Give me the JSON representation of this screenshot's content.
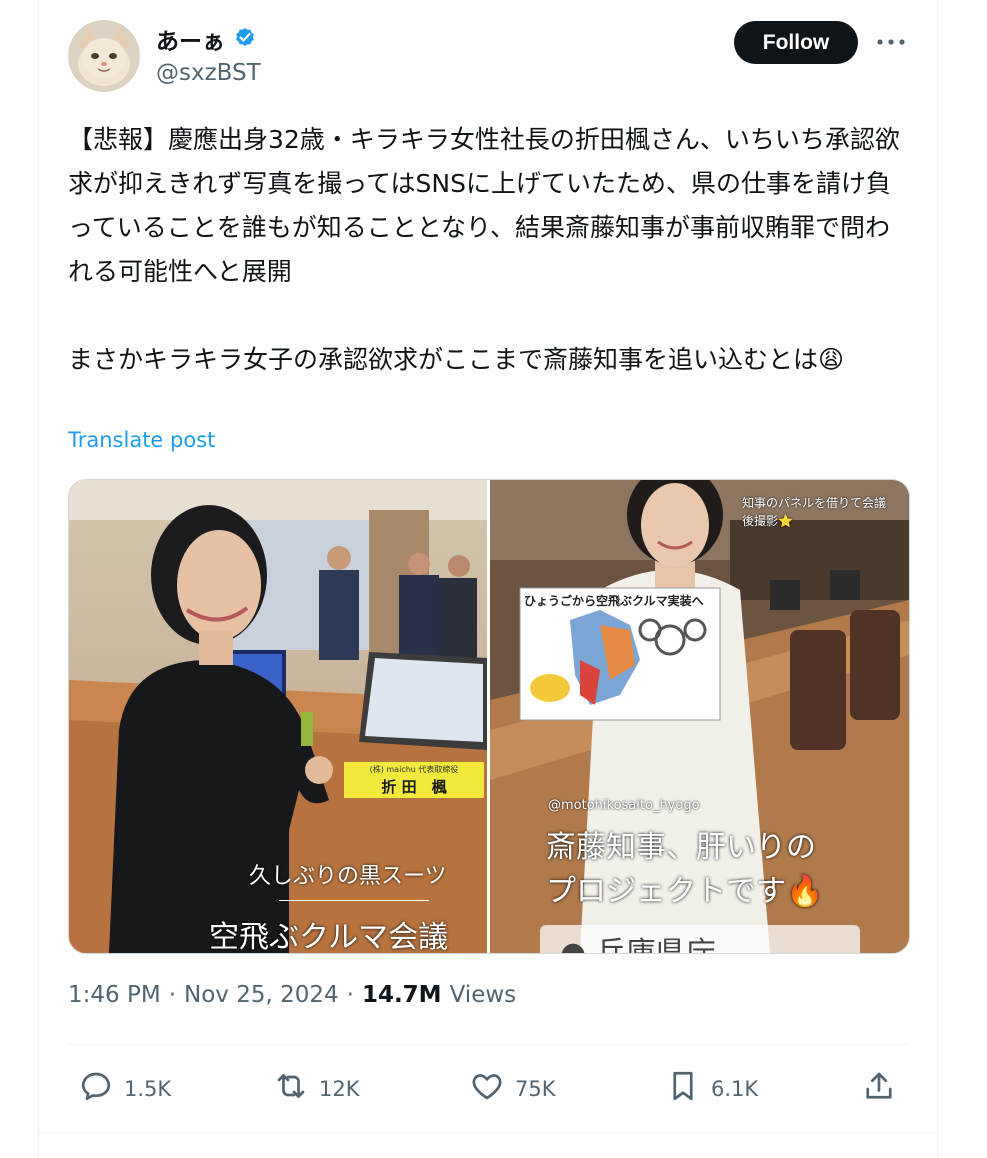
{
  "author": {
    "display_name": "あーぁ",
    "handle": "@sxzBST",
    "verified": true
  },
  "follow_label": "Follow",
  "tweet": {
    "paragraph1": "【悲報】慶應出身32歳・キラキラ女性社長の折田楓さん、いちいち承認欲求が抑えきれず写真を撮ってはSNSに上げていたため、県の仕事を請け負っていることを誰もが知ることとなり、結果斎藤知事が事前収賄罪で問われる可能性へと展開",
    "paragraph2": "まさかキラキラ女子の承認欲求がここまで斎藤知事を追い込むとは😩"
  },
  "translate_label": "Translate post",
  "photos": {
    "left": {
      "nameplate_title": "(株) maichu 代表取締役",
      "nameplate_name": "折 田　楓",
      "caption1": "久しぶりの黒スーツ",
      "caption2": "空飛ぶクルマ会議"
    },
    "right": {
      "top_note": "知事のパネルを借りて会議後撮影⭐",
      "panel_title": "ひょうごから空飛ぶクルマ実装へ",
      "tag": "@motohikosaito_hyogo",
      "caption1": "斎藤知事、肝いりの",
      "caption2": "プロジェクトです🔥",
      "partial": "● 兵庫県庁"
    }
  },
  "meta": {
    "time": "1:46 PM",
    "sep1": "·",
    "date": "Nov 25, 2024",
    "sep2": "·",
    "views_count": "14.7M",
    "views_label": "Views"
  },
  "actions": {
    "replies": "1.5K",
    "reposts": "12K",
    "likes": "75K",
    "bookmarks": "6.1K"
  },
  "colors": {
    "accent": "#1d9bf0",
    "text": "#0f1419",
    "secondary": "#536471"
  }
}
